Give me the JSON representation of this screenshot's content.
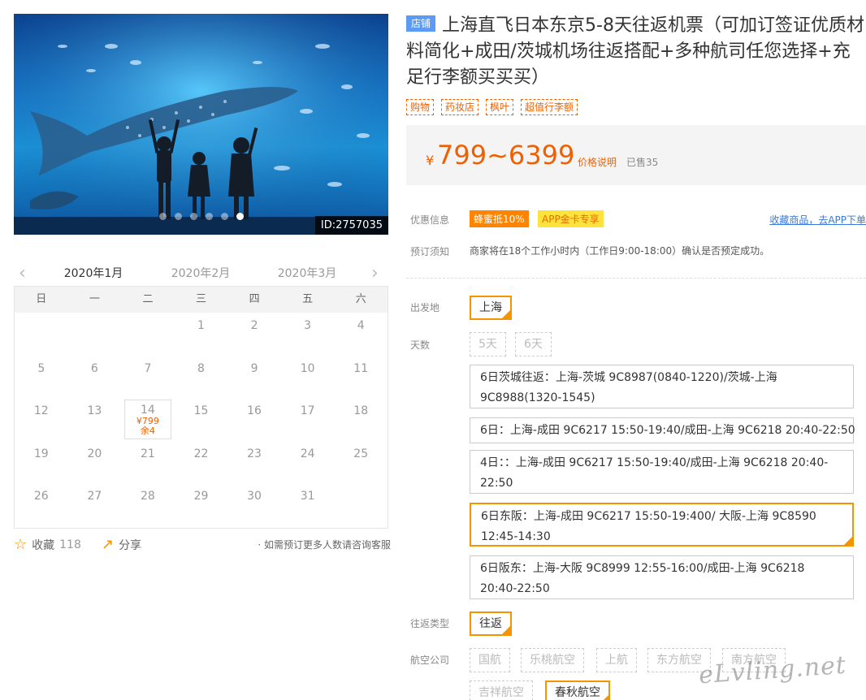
{
  "gallery": {
    "image_id": "ID:2757035",
    "dot_count": 6,
    "active_dot": 5
  },
  "calendar": {
    "prev_icon": "chevron-left-icon",
    "next_icon": "chevron-right-icon",
    "months": [
      "2020年1月",
      "2020年2月",
      "2020年3月"
    ],
    "active_month": 0,
    "weekdays": [
      "日",
      "一",
      "二",
      "三",
      "四",
      "五",
      "六"
    ],
    "weeks": [
      [
        "",
        "",
        "",
        "1",
        "2",
        "3",
        "4"
      ],
      [
        "5",
        "6",
        "7",
        "8",
        "9",
        "10",
        "11"
      ],
      [
        "12",
        "13",
        "14",
        "15",
        "16",
        "17",
        "18"
      ],
      [
        "19",
        "20",
        "21",
        "22",
        "23",
        "24",
        "25"
      ],
      [
        "26",
        "27",
        "28",
        "29",
        "30",
        "31",
        ""
      ]
    ],
    "selected_day": {
      "day": "14",
      "price": "¥799",
      "stock": "余4"
    }
  },
  "actions": {
    "favorite_icon": "star-icon",
    "favorite_label": "收藏",
    "favorite_count": "118",
    "share_icon": "share-icon",
    "share_label": "分享",
    "note": "· 如需预订更多人数请咨询客服"
  },
  "product": {
    "shop_badge": "店铺",
    "title": "上海直飞日本东京5-8天往返机票（可加订签证优质材料简化+成田/茨城机场往返搭配+多种航司任您选择+充足行李额买买买）",
    "tags": [
      "购物",
      "药妆店",
      "枫叶",
      "超值行李额"
    ],
    "price_symbol": "¥",
    "price": "799~6399",
    "price_explain": "价格说明",
    "sold": "已售35"
  },
  "promo": {
    "label": "优惠信息",
    "badges": [
      "蜂蜜抵10%",
      "APP金卡专享"
    ],
    "fav_link": "收藏商品，去APP下单"
  },
  "booking": {
    "label": "预订须知",
    "text": "商家将在18个工作小时内（工作日9:00-18:00）确认是否预定成功。"
  },
  "options": {
    "departure_label": "出发地",
    "departure": "上海",
    "days_label": "天数",
    "days": [
      "5天",
      "6天"
    ],
    "flights": [
      "6日茨城往返：上海-茨城 9C8987(0840-1220)/茨城-上海 9C8988(1320-1545)",
      "6日：上海-成田 9C6217 15:50-19:40/成田-上海 9C6218 20:40-22:50",
      "4日：：上海-成田 9C6217 15:50-19:40/成田-上海 9C6218 20:40-22:50",
      "6日东阪：上海-成田 9C6217 15:50-19:400/ 大阪-上海 9C8590 12:45-14:30",
      "6日阪东：上海-大阪 9C8999 12:55-16:00/成田-上海 9C6218 20:40-22:50"
    ],
    "selected_flight": 3,
    "trip_label": "往返类型",
    "trip": "往返",
    "airline_label": "航空公司",
    "airlines": [
      "国航",
      "乐桃航空",
      "上航",
      "东方航空",
      "南方航空",
      "吉祥航空",
      "春秋航空"
    ],
    "selected_airline": 6
  },
  "watermark": "eLvling.net"
}
